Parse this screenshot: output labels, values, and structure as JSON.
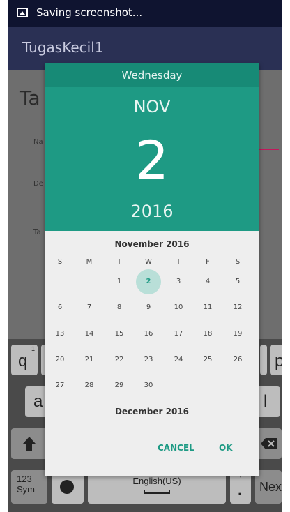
{
  "status_bar": {
    "text": "Saving screenshot...",
    "icon": "image-icon"
  },
  "app": {
    "title": "TugasKecil1",
    "heading": "Ta",
    "label_1": "Na",
    "label_2": "De",
    "label_3": "Ta"
  },
  "dialog": {
    "weekday": "Wednesday",
    "month_abbr": "NOV",
    "day": "2",
    "year": "2016",
    "month_title": "November 2016",
    "next_month_title": "December 2016",
    "weekday_headers": [
      "S",
      "M",
      "T",
      "W",
      "T",
      "F",
      "S"
    ],
    "dates": {
      "d1": "1",
      "d2": "2",
      "d3": "3",
      "d4": "4",
      "d5": "5",
      "d6": "6",
      "d7": "7",
      "d8": "8",
      "d9": "9",
      "d10": "10",
      "d11": "11",
      "d12": "12",
      "d13": "13",
      "d14": "14",
      "d15": "15",
      "d16": "16",
      "d17": "17",
      "d18": "18",
      "d19": "19",
      "d20": "20",
      "d21": "21",
      "d22": "22",
      "d23": "23",
      "d24": "24",
      "d25": "25",
      "d26": "26",
      "d27": "27",
      "d28": "28",
      "d29": "29",
      "d30": "30"
    },
    "selected_day": "2",
    "accent_color": "#1e9a84",
    "cancel_label": "CANCEL",
    "ok_label": "OK"
  },
  "keyboard": {
    "q": "q",
    "q_hint": "1",
    "p": "p",
    "p_hint": "0",
    "a": "a",
    "l": "l",
    "sym": "123\nSym",
    "emoji_hint": "''!",
    "space_label": "English(US)",
    "period": ".",
    "period_hint": "'',?",
    "next": "Next",
    "shift_icon": "shift-icon",
    "backspace_icon": "backspace-icon"
  }
}
